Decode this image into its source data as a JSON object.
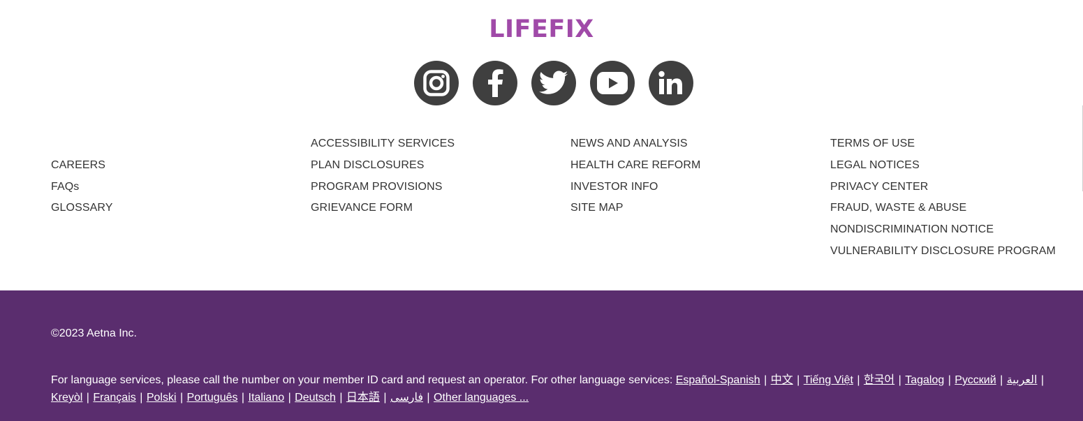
{
  "brand": {
    "logo_text": "LIFEFIX",
    "logo_color": "#a04aa8"
  },
  "social": [
    {
      "name": "instagram-icon"
    },
    {
      "name": "facebook-icon"
    },
    {
      "name": "twitter-icon"
    },
    {
      "name": "youtube-icon"
    },
    {
      "name": "linkedin-icon"
    }
  ],
  "footer_links": {
    "col1": [
      "",
      "CAREERS",
      "FAQs",
      "GLOSSARY"
    ],
    "col2": [
      "ACCESSIBILITY SERVICES",
      "PLAN DISCLOSURES",
      "PROGRAM PROVISIONS",
      "GRIEVANCE FORM"
    ],
    "col3": [
      "NEWS AND ANALYSIS",
      "HEALTH CARE REFORM",
      "INVESTOR INFO",
      "SITE MAP"
    ],
    "col4": [
      "TERMS OF USE",
      "LEGAL NOTICES",
      "PRIVACY CENTER",
      "FRAUD, WASTE & ABUSE",
      "NONDISCRIMINATION NOTICE",
      "VULNERABILITY DISCLOSURE PROGRAM"
    ]
  },
  "bottom": {
    "background": "#5a2d6e",
    "copyright": "©2023 Aetna Inc.",
    "language_intro": "For language services, please call the number on your member ID card and request an operator. For other language services: ",
    "languages": [
      "Español-Spanish",
      "中文",
      "Tiếng Việt",
      "한국어",
      "Tagalog",
      "Русский",
      "العربية",
      "Kreyòl",
      "Français",
      "Polski",
      "Português",
      "Italiano",
      "Deutsch",
      "日本語",
      "فارسی",
      "Other languages ..."
    ]
  }
}
